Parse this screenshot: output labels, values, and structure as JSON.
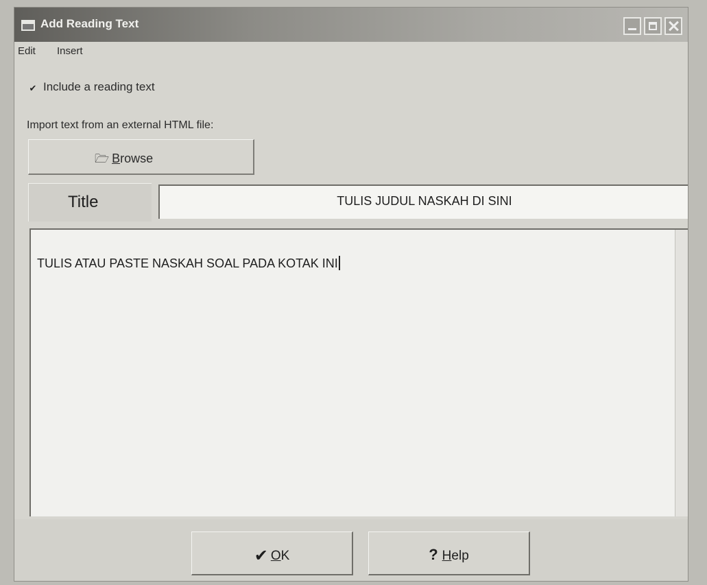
{
  "window": {
    "title": "Add Reading Text",
    "controls": {
      "minimize": "minimize",
      "maximize": "maximize",
      "close": "close"
    }
  },
  "menu": {
    "edit": "Edit",
    "insert": "Insert"
  },
  "include_checkbox": {
    "checked": true,
    "mark": "✔",
    "label": "Include a reading text"
  },
  "import": {
    "label": "Import text from an external HTML file:",
    "browse_icon": "folder-open-icon",
    "browse_mnemonic": "B",
    "browse_rest": "rowse"
  },
  "title_field": {
    "label": "Title",
    "value": "TULIS JUDUL NASKAH DI SINI"
  },
  "reading_text": {
    "value": "TULIS ATAU PASTE NASKAH SOAL PADA KOTAK INI"
  },
  "buttons": {
    "ok": {
      "icon": "✔",
      "mnemonic": "O",
      "rest": "K"
    },
    "help": {
      "icon": "?",
      "mnemonic": "H",
      "rest": "elp"
    }
  }
}
